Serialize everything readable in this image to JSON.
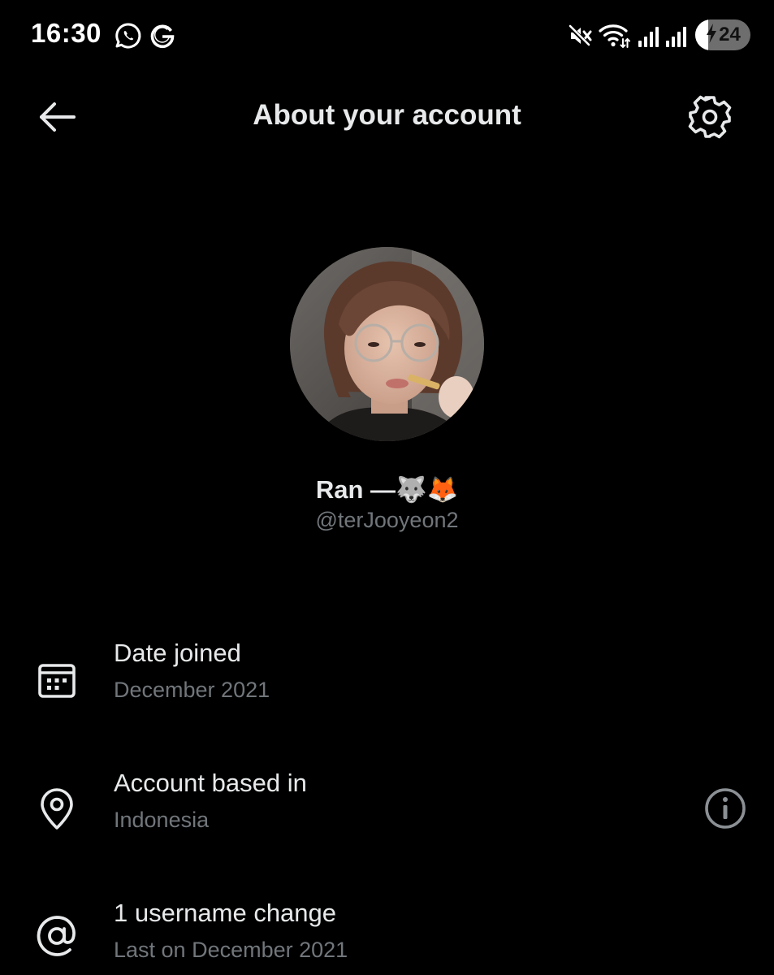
{
  "status_bar": {
    "time": "16:30",
    "notification_icons": [
      "whatsapp-icon",
      "google-icon"
    ],
    "system_icons": [
      "vibrate-mute-icon",
      "wifi-icon",
      "signal-icon",
      "signal-icon"
    ],
    "battery_level": "24",
    "battery_charging": true,
    "battery_fraction": 0.24
  },
  "header": {
    "title": "About your account",
    "back_icon": "arrow-left-icon",
    "settings_icon": "gear-icon"
  },
  "profile": {
    "avatar": "profile-photo",
    "name": "Ran —🐺🦊",
    "handle": "@terJooyeon2"
  },
  "info_rows": [
    {
      "icon": "calendar-icon",
      "title": "Date joined",
      "subtitle": "December 2021"
    },
    {
      "icon": "location-pin-icon",
      "title": "Account based in",
      "subtitle": "Indonesia",
      "action_icon": "info-icon"
    },
    {
      "icon": "at-sign-icon",
      "title": "1 username change",
      "subtitle": "Last on December 2021"
    }
  ],
  "colors": {
    "background": "#000000",
    "primary_text": "#e7e9ea",
    "secondary_text": "#71767b"
  }
}
